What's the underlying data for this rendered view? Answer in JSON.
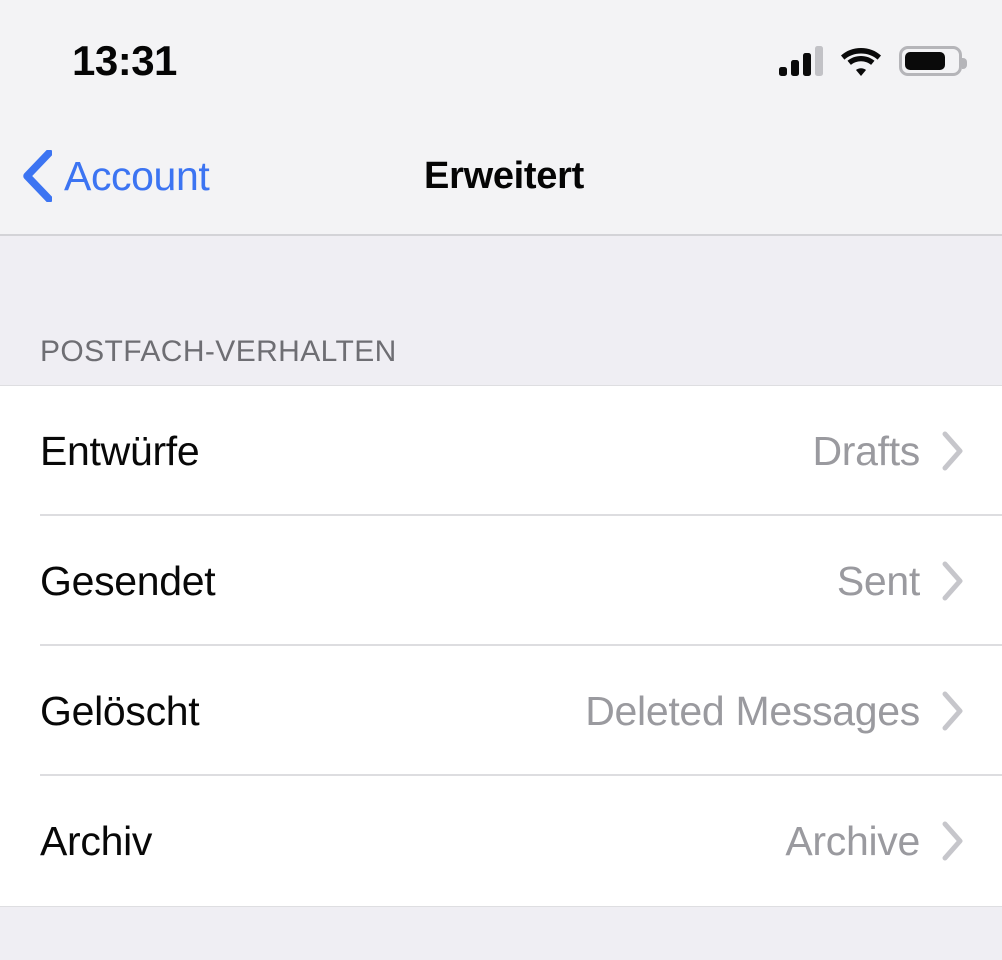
{
  "status_bar": {
    "time": "13:31",
    "signal_icon": "cellular-signal-icon",
    "signal_bars_filled": 3,
    "signal_bars_total": 4,
    "wifi_icon": "wifi-icon",
    "battery_icon": "battery-icon",
    "battery_level_percent": 78
  },
  "nav_bar": {
    "back_icon": "chevron-left-icon",
    "back_label": "Account",
    "title": "Erweitert",
    "accent_color": "#3C74F2"
  },
  "section": {
    "header": "POSTFACH-VERHALTEN",
    "rows": [
      {
        "label": "Entwürfe",
        "value": "Drafts",
        "chevron_icon": "chevron-right-icon"
      },
      {
        "label": "Gesendet",
        "value": "Sent",
        "chevron_icon": "chevron-right-icon"
      },
      {
        "label": "Gelöscht",
        "value": "Deleted Messages",
        "chevron_icon": "chevron-right-icon"
      },
      {
        "label": "Archiv",
        "value": "Archive",
        "chevron_icon": "chevron-right-icon"
      }
    ]
  },
  "colors": {
    "background": "#EFEEF3",
    "bar_background": "#F3F3F5",
    "list_background": "#FFFFFF",
    "label_text": "#080808",
    "value_text": "#9A9A9F",
    "header_text": "#6E6E73",
    "separator": "#DDDDE0"
  }
}
